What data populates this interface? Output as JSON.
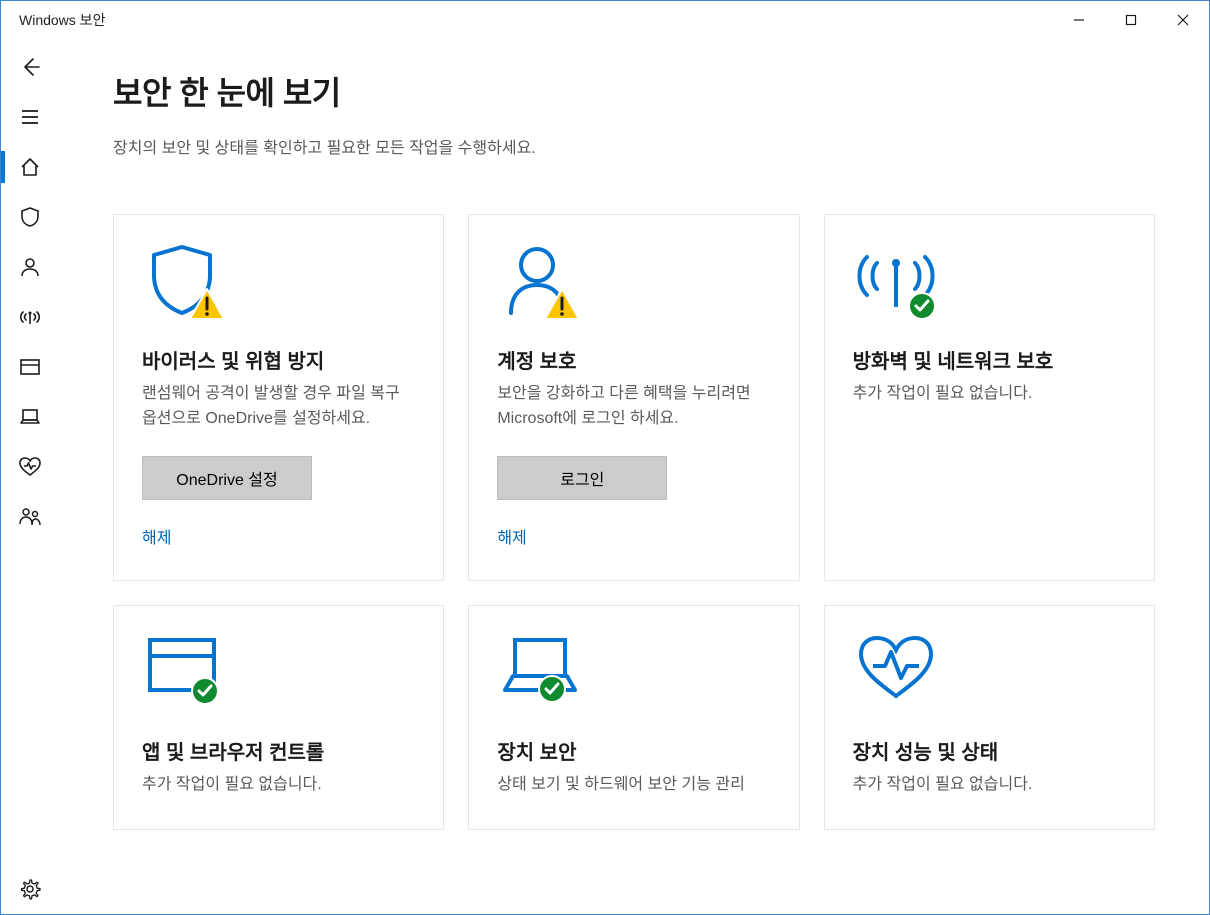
{
  "window": {
    "title": "Windows 보안"
  },
  "page": {
    "title": "보안 한 눈에 보기",
    "subtitle": "장치의 보안 및 상태를 확인하고 필요한 모든 작업을 수행하세요."
  },
  "tiles": {
    "virus": {
      "title": "바이러스 및 위협 방지",
      "desc": "랜섬웨어 공격이 발생할 경우 파일 복구 옵션으로 OneDrive를 설정하세요.",
      "action": "OneDrive 설정",
      "dismiss": "해제"
    },
    "account": {
      "title": "계정 보호",
      "desc": "보안을 강화하고 다른 혜택을 누리려면 Microsoft에 로그인 하세요.",
      "action": "로그인",
      "dismiss": "해제"
    },
    "firewall": {
      "title": "방화벽 및 네트워크 보호",
      "desc": "추가 작업이 필요 없습니다."
    },
    "appbrowser": {
      "title": "앱 및 브라우저 컨트롤",
      "desc": "추가 작업이 필요 없습니다."
    },
    "device": {
      "title": "장치 보안",
      "desc": "상태 보기 및 하드웨어 보안 기능 관리"
    },
    "health": {
      "title": "장치 성능 및 상태",
      "desc": "추가 작업이 필요 없습니다."
    }
  }
}
